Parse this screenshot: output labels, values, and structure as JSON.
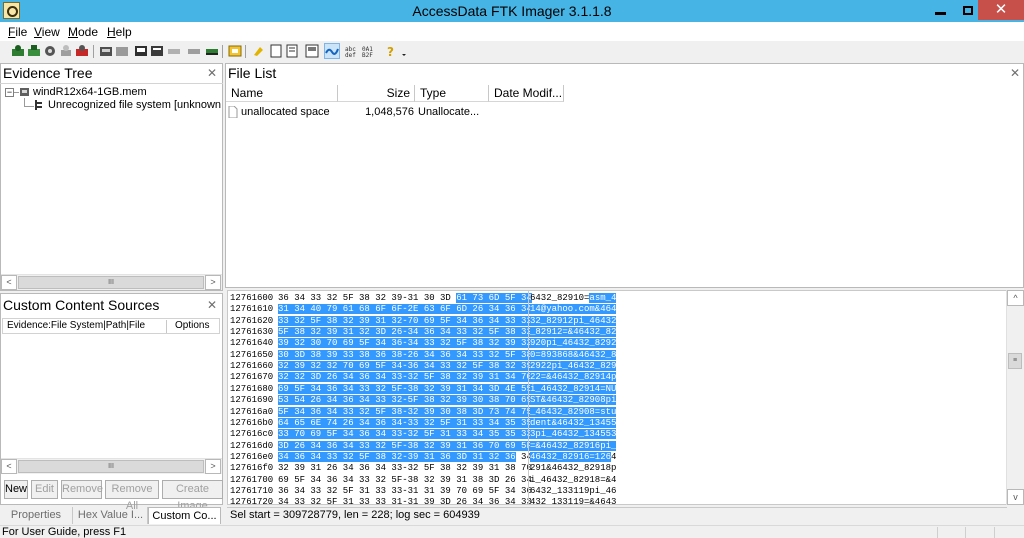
{
  "window": {
    "title": "AccessData FTK Imager 3.1.1.8"
  },
  "menu": [
    {
      "label": "File",
      "u": "F",
      "rest": "ile"
    },
    {
      "label": "View",
      "u": "V",
      "rest": "iew"
    },
    {
      "label": "Mode",
      "u": "M",
      "rest": "ode"
    },
    {
      "label": "Help",
      "u": "H",
      "rest": "elp"
    }
  ],
  "evidence_tree": {
    "title": "Evidence Tree",
    "root_label": "windR12x64-1GB.mem",
    "child_label": "Unrecognized file system [unknown typ"
  },
  "file_list": {
    "title": "File List",
    "columns": [
      "Name",
      "Size",
      "Type",
      "Date Modif..."
    ],
    "rows": [
      {
        "name": "unallocated space",
        "size": "1,048,576",
        "type": "Unallocate..."
      }
    ]
  },
  "custom_content": {
    "title": "Custom Content Sources",
    "columns": [
      "Evidence:File System|Path|File",
      "Options"
    ],
    "buttons": {
      "new": "New",
      "edit": "Edit",
      "remove": "Remove",
      "remove_all": "Remove All",
      "create_image": "Create Image"
    }
  },
  "bottom_tabs": [
    "Properties",
    "Hex Value I...",
    "Custom Co..."
  ],
  "hex_view": {
    "lines": [
      {
        "offset": "12761600",
        "sel_bytes": "",
        "bytes": "36 34 33 32 5F 38 32 39-31 30 3D ",
        "sel_bytes2": "61 73 6D 5F 34",
        "ascii": "6432_82910=",
        "sel_ascii": "asm_4"
      },
      {
        "offset": "12761610",
        "sel_bytes": "31 34 40 79 61 68 6F 6F-2E 63 6F 6D 26 34 36 34",
        "bytes": "",
        "sel_bytes2": "",
        "ascii": "",
        "sel_ascii": "14@yahoo.com&464"
      },
      {
        "offset": "12761620",
        "sel_bytes": "33 32 5F 38 32 39 31 32-70 69 5F 34 36 34 33 32",
        "bytes": "",
        "sel_bytes2": "",
        "ascii": "",
        "sel_ascii": "32_82912pi_46432"
      },
      {
        "offset": "12761630",
        "sel_bytes": "5F 38 32 39 31 32 3D 26-34 36 34 33 32 5F 38 32",
        "bytes": "",
        "sel_bytes2": "",
        "ascii": "",
        "sel_ascii": "_82912=&46432_82"
      },
      {
        "offset": "12761640",
        "sel_bytes": "39 32 30 70 69 5F 34 36-34 33 32 5F 38 32 39 32",
        "bytes": "",
        "sel_bytes2": "",
        "ascii": "",
        "sel_ascii": "920pi_46432_8292"
      },
      {
        "offset": "12761650",
        "sel_bytes": "30 3D 38 39 33 38 36 38-26 34 36 34 33 32 5F 38",
        "bytes": "",
        "sel_bytes2": "",
        "ascii": "",
        "sel_ascii": "0=893868&46432_8"
      },
      {
        "offset": "12761660",
        "sel_bytes": "32 39 32 32 70 69 5F 34-36 34 33 32 5F 38 32 39",
        "bytes": "",
        "sel_bytes2": "",
        "ascii": "",
        "sel_ascii": "2922pi_46432_829"
      },
      {
        "offset": "12761670",
        "sel_bytes": "32 32 3D 26 34 36 34 33-32 5F 38 32 39 31 34 70",
        "bytes": "",
        "sel_bytes2": "",
        "ascii": "",
        "sel_ascii": "22=&46432_82914p"
      },
      {
        "offset": "12761680",
        "sel_bytes": "69 5F 34 36 34 33 32 5F-38 32 39 31 34 3D 4E 55",
        "bytes": "",
        "sel_bytes2": "",
        "ascii": "",
        "sel_ascii": "i_46432_82914=NU"
      },
      {
        "offset": "12761690",
        "sel_bytes": "53 54 26 34 36 34 33 32-5F 38 32 39 30 38 70 69",
        "bytes": "",
        "sel_bytes2": "",
        "ascii": "",
        "sel_ascii": "ST&46432_82908pi"
      },
      {
        "offset": "127616a0",
        "sel_bytes": "5F 34 36 34 33 32 5F 38-32 39 30 38 3D 73 74 75",
        "bytes": "",
        "sel_bytes2": "",
        "ascii": "",
        "sel_ascii": "_46432_82908=stu"
      },
      {
        "offset": "127616b0",
        "sel_bytes": "64 65 6E 74 26 34 36 34-33 32 5F 31 33 34 35 35",
        "bytes": "",
        "sel_bytes2": "",
        "ascii": "",
        "sel_ascii": "dent&46432_13455"
      },
      {
        "offset": "127616c0",
        "sel_bytes": "33 70 69 5F 34 36 34 33-32 5F 31 33 34 35 35 33",
        "bytes": "",
        "sel_bytes2": "",
        "ascii": "",
        "sel_ascii": "3pi_46432_134553"
      },
      {
        "offset": "127616d0",
        "sel_bytes": "3D 26 34 36 34 33 32 5F-38 32 39 31 36 70 69 5F",
        "bytes": "",
        "sel_bytes2": "",
        "ascii": "",
        "sel_ascii": "=&46432_82916pi_"
      },
      {
        "offset": "127616e0",
        "sel_bytes": "34 36 34 33 32 5F 38 32-39 31 36 3D 31 32 36",
        "bytes": " 34",
        "sel_bytes2": "",
        "ascii": "4",
        "sel_ascii": "46432_82916=126",
        "ascii_after": true
      },
      {
        "offset": "127616f0",
        "sel_bytes": "",
        "bytes": "32 39 31 26 34 36 34 33-32 5F 38 32 39 31 38 70",
        "sel_bytes2": "",
        "ascii": "291&46432_82918p",
        "sel_ascii": ""
      },
      {
        "offset": "12761700",
        "sel_bytes": "",
        "bytes": "69 5F 34 36 34 33 32 5F-38 32 39 31 38 3D 26 34",
        "sel_bytes2": "",
        "ascii": "i_46432_82918=&4",
        "sel_ascii": ""
      },
      {
        "offset": "12761710",
        "sel_bytes": "",
        "bytes": "36 34 33 32 5F 31 33 33-31 31 39 70 69 5F 34 36",
        "sel_bytes2": "",
        "ascii": "6432_133119pi_46",
        "sel_ascii": ""
      },
      {
        "offset": "12761720",
        "sel_bytes": "",
        "bytes": "34 33 32 5F 31 33 33 31-31 39 3D 26 34 36 34 33",
        "sel_bytes2": "",
        "ascii": "432_133119=&4643",
        "sel_ascii": ""
      }
    ],
    "status": "Sel start = 309728779, len = 228; log sec = 604939"
  },
  "statusbar": {
    "text": "For User Guide, press F1"
  }
}
